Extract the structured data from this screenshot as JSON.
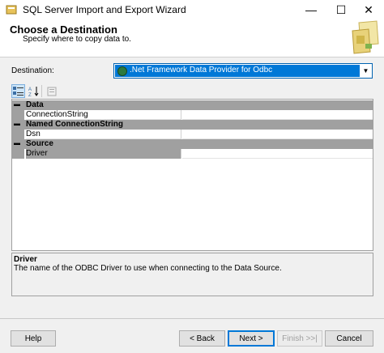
{
  "window": {
    "title": "SQL Server Import and Export Wizard",
    "minimize": "—",
    "maximize": "☐",
    "close": "✕"
  },
  "header": {
    "title": "Choose a Destination",
    "subtitle": "Specify where to copy data to."
  },
  "destination": {
    "label": "Destination:",
    "selected": ".Net Framework Data Provider for Odbc"
  },
  "toolbar": {
    "categorized": "categorized-icon",
    "alphabetical": "alphabetical-icon",
    "property_pages": "property-pages-icon"
  },
  "grid": {
    "categories": [
      {
        "name": "Data",
        "properties": [
          {
            "name": "ConnectionString",
            "value": ""
          }
        ]
      },
      {
        "name": "Named ConnectionString",
        "properties": [
          {
            "name": "Dsn",
            "value": ""
          }
        ]
      },
      {
        "name": "Source",
        "properties": [
          {
            "name": "Driver",
            "value": ""
          }
        ]
      }
    ],
    "selected_property": "Driver"
  },
  "description": {
    "title": "Driver",
    "text": "The name of the ODBC Driver to use when connecting to the Data Source."
  },
  "buttons": {
    "help": "Help",
    "back": "< Back",
    "next": "Next >",
    "finish": "Finish >>|",
    "cancel": "Cancel"
  },
  "colors": {
    "accent": "#0078d7",
    "category_bg": "#a0a0a0"
  }
}
